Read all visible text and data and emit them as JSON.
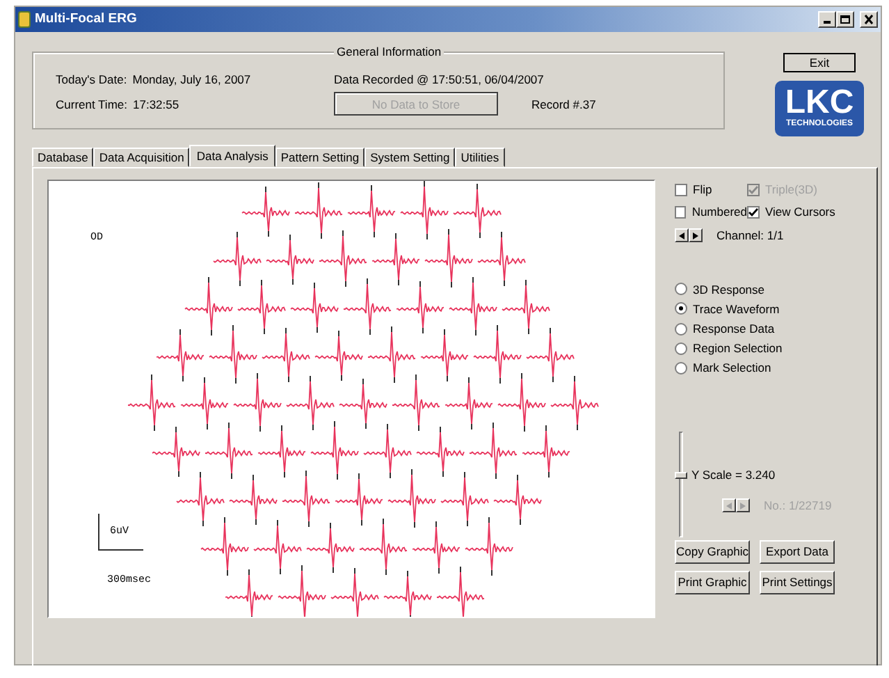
{
  "window": {
    "title": "Multi-Focal ERG"
  },
  "general_info": {
    "title": "General Information",
    "todays_date_label": "Today's Date:",
    "todays_date": "Monday, July 16, 2007",
    "current_time_label": "Current Time:",
    "current_time": "17:32:55",
    "data_recorded": "Data Recorded @ 17:50:51, 06/04/2007",
    "store_button": {
      "label": "No Data to Store",
      "disabled": true
    },
    "record": "Record #.37"
  },
  "exit_button": "Exit",
  "logo": {
    "name": "LKC",
    "subtitle": "TECHNOLOGIES"
  },
  "tabs": [
    {
      "label": "Database",
      "selected": false
    },
    {
      "label": "Data Acquisition",
      "selected": false
    },
    {
      "label": "Data Analysis",
      "selected": true
    },
    {
      "label": "Pattern Setting",
      "selected": false
    },
    {
      "label": "System Setting",
      "selected": false
    },
    {
      "label": "Utilities",
      "selected": false
    }
  ],
  "plot": {
    "eye_label": "OD",
    "scale_amplitude": "6uV",
    "scale_time": "300msec"
  },
  "checkboxes": [
    {
      "label": "Flip",
      "checked": false,
      "disabled": false
    },
    {
      "label": "Triple(3D)",
      "checked": true,
      "disabled": true
    },
    {
      "label": "Numbered",
      "checked": false,
      "disabled": false
    },
    {
      "label": "View Cursors",
      "checked": true,
      "disabled": false
    }
  ],
  "channel": "Channel: 1/1",
  "views": [
    {
      "label": "3D Response",
      "selected": false
    },
    {
      "label": "Trace Waveform",
      "selected": true
    },
    {
      "label": "Response Data",
      "selected": false
    },
    {
      "label": "Region Selection",
      "selected": false
    },
    {
      "label": "Mark Selection",
      "selected": false
    }
  ],
  "y_scale": {
    "label": "Y Scale = 3.240",
    "level": 0.6
  },
  "record_nav": {
    "label": "No.: 1/22719",
    "disabled": true
  },
  "buttons": [
    "Copy Graphic",
    "Export Data",
    "Print Graphic",
    "Print Settings"
  ]
}
